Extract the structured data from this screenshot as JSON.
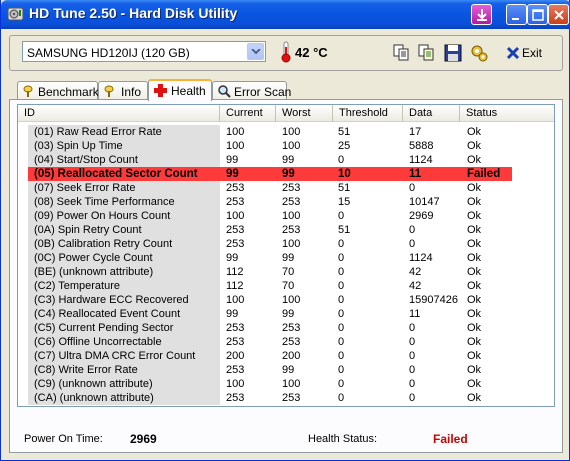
{
  "window": {
    "title": "HD Tune 2.50 - Hard Disk Utility"
  },
  "toolbar": {
    "drive_selected": "SAMSUNG HD120IJ (120 GB)",
    "temperature": "42 °C",
    "exit_label": "Exit"
  },
  "tabs": [
    {
      "label": "Benchmark",
      "active": false
    },
    {
      "label": "Info",
      "active": false
    },
    {
      "label": "Health",
      "active": true
    },
    {
      "label": "Error Scan",
      "active": false
    }
  ],
  "table": {
    "columns": [
      "ID",
      "Current",
      "Worst",
      "Threshold",
      "Data",
      "Status"
    ],
    "rows": [
      [
        "(01) Raw Read Error Rate",
        "100",
        "100",
        "51",
        "17",
        "Ok"
      ],
      [
        "(03) Spin Up Time",
        "100",
        "100",
        "25",
        "5888",
        "Ok"
      ],
      [
        "(04) Start/Stop Count",
        "99",
        "99",
        "0",
        "1124",
        "Ok"
      ],
      [
        "(05) Reallocated Sector Count",
        "99",
        "99",
        "10",
        "11",
        "Failed"
      ],
      [
        "(07) Seek Error Rate",
        "253",
        "253",
        "51",
        "0",
        "Ok"
      ],
      [
        "(08) Seek Time Performance",
        "253",
        "253",
        "15",
        "10147",
        "Ok"
      ],
      [
        "(09) Power On Hours Count",
        "100",
        "100",
        "0",
        "2969",
        "Ok"
      ],
      [
        "(0A) Spin Retry Count",
        "253",
        "253",
        "51",
        "0",
        "Ok"
      ],
      [
        "(0B) Calibration Retry Count",
        "253",
        "100",
        "0",
        "0",
        "Ok"
      ],
      [
        "(0C) Power Cycle Count",
        "99",
        "99",
        "0",
        "1124",
        "Ok"
      ],
      [
        "(BE) (unknown attribute)",
        "112",
        "70",
        "0",
        "42",
        "Ok"
      ],
      [
        "(C2) Temperature",
        "112",
        "70",
        "0",
        "42",
        "Ok"
      ],
      [
        "(C3) Hardware ECC Recovered",
        "100",
        "100",
        "0",
        "15907426",
        "Ok"
      ],
      [
        "(C4) Reallocated Event Count",
        "99",
        "99",
        "0",
        "11",
        "Ok"
      ],
      [
        "(C5) Current Pending Sector",
        "253",
        "253",
        "0",
        "0",
        "Ok"
      ],
      [
        "(C6) Offline Uncorrectable",
        "253",
        "253",
        "0",
        "0",
        "Ok"
      ],
      [
        "(C7) Ultra DMA CRC Error Count",
        "200",
        "200",
        "0",
        "0",
        "Ok"
      ],
      [
        "(C8) Write Error Rate",
        "253",
        "99",
        "0",
        "0",
        "Ok"
      ],
      [
        "(C9) (unknown attribute)",
        "100",
        "100",
        "0",
        "0",
        "Ok"
      ],
      [
        "(CA) (unknown attribute)",
        "253",
        "253",
        "0",
        "0",
        "Ok"
      ]
    ],
    "failed_row_index": 3,
    "failed_color": "#ff3a3a"
  },
  "footer": {
    "power_on_label": "Power On Time:",
    "power_on_value": "2969",
    "health_label": "Health Status:",
    "health_value": "Failed",
    "health_color": "#cc0000"
  },
  "icons": {
    "app": "hdtune-icon",
    "thermometer": "thermometer-icon",
    "copy": "copy-icon",
    "copy_all": "copy-all-icon",
    "save": "save-icon",
    "options": "options-icon",
    "exit": "exit-icon"
  }
}
